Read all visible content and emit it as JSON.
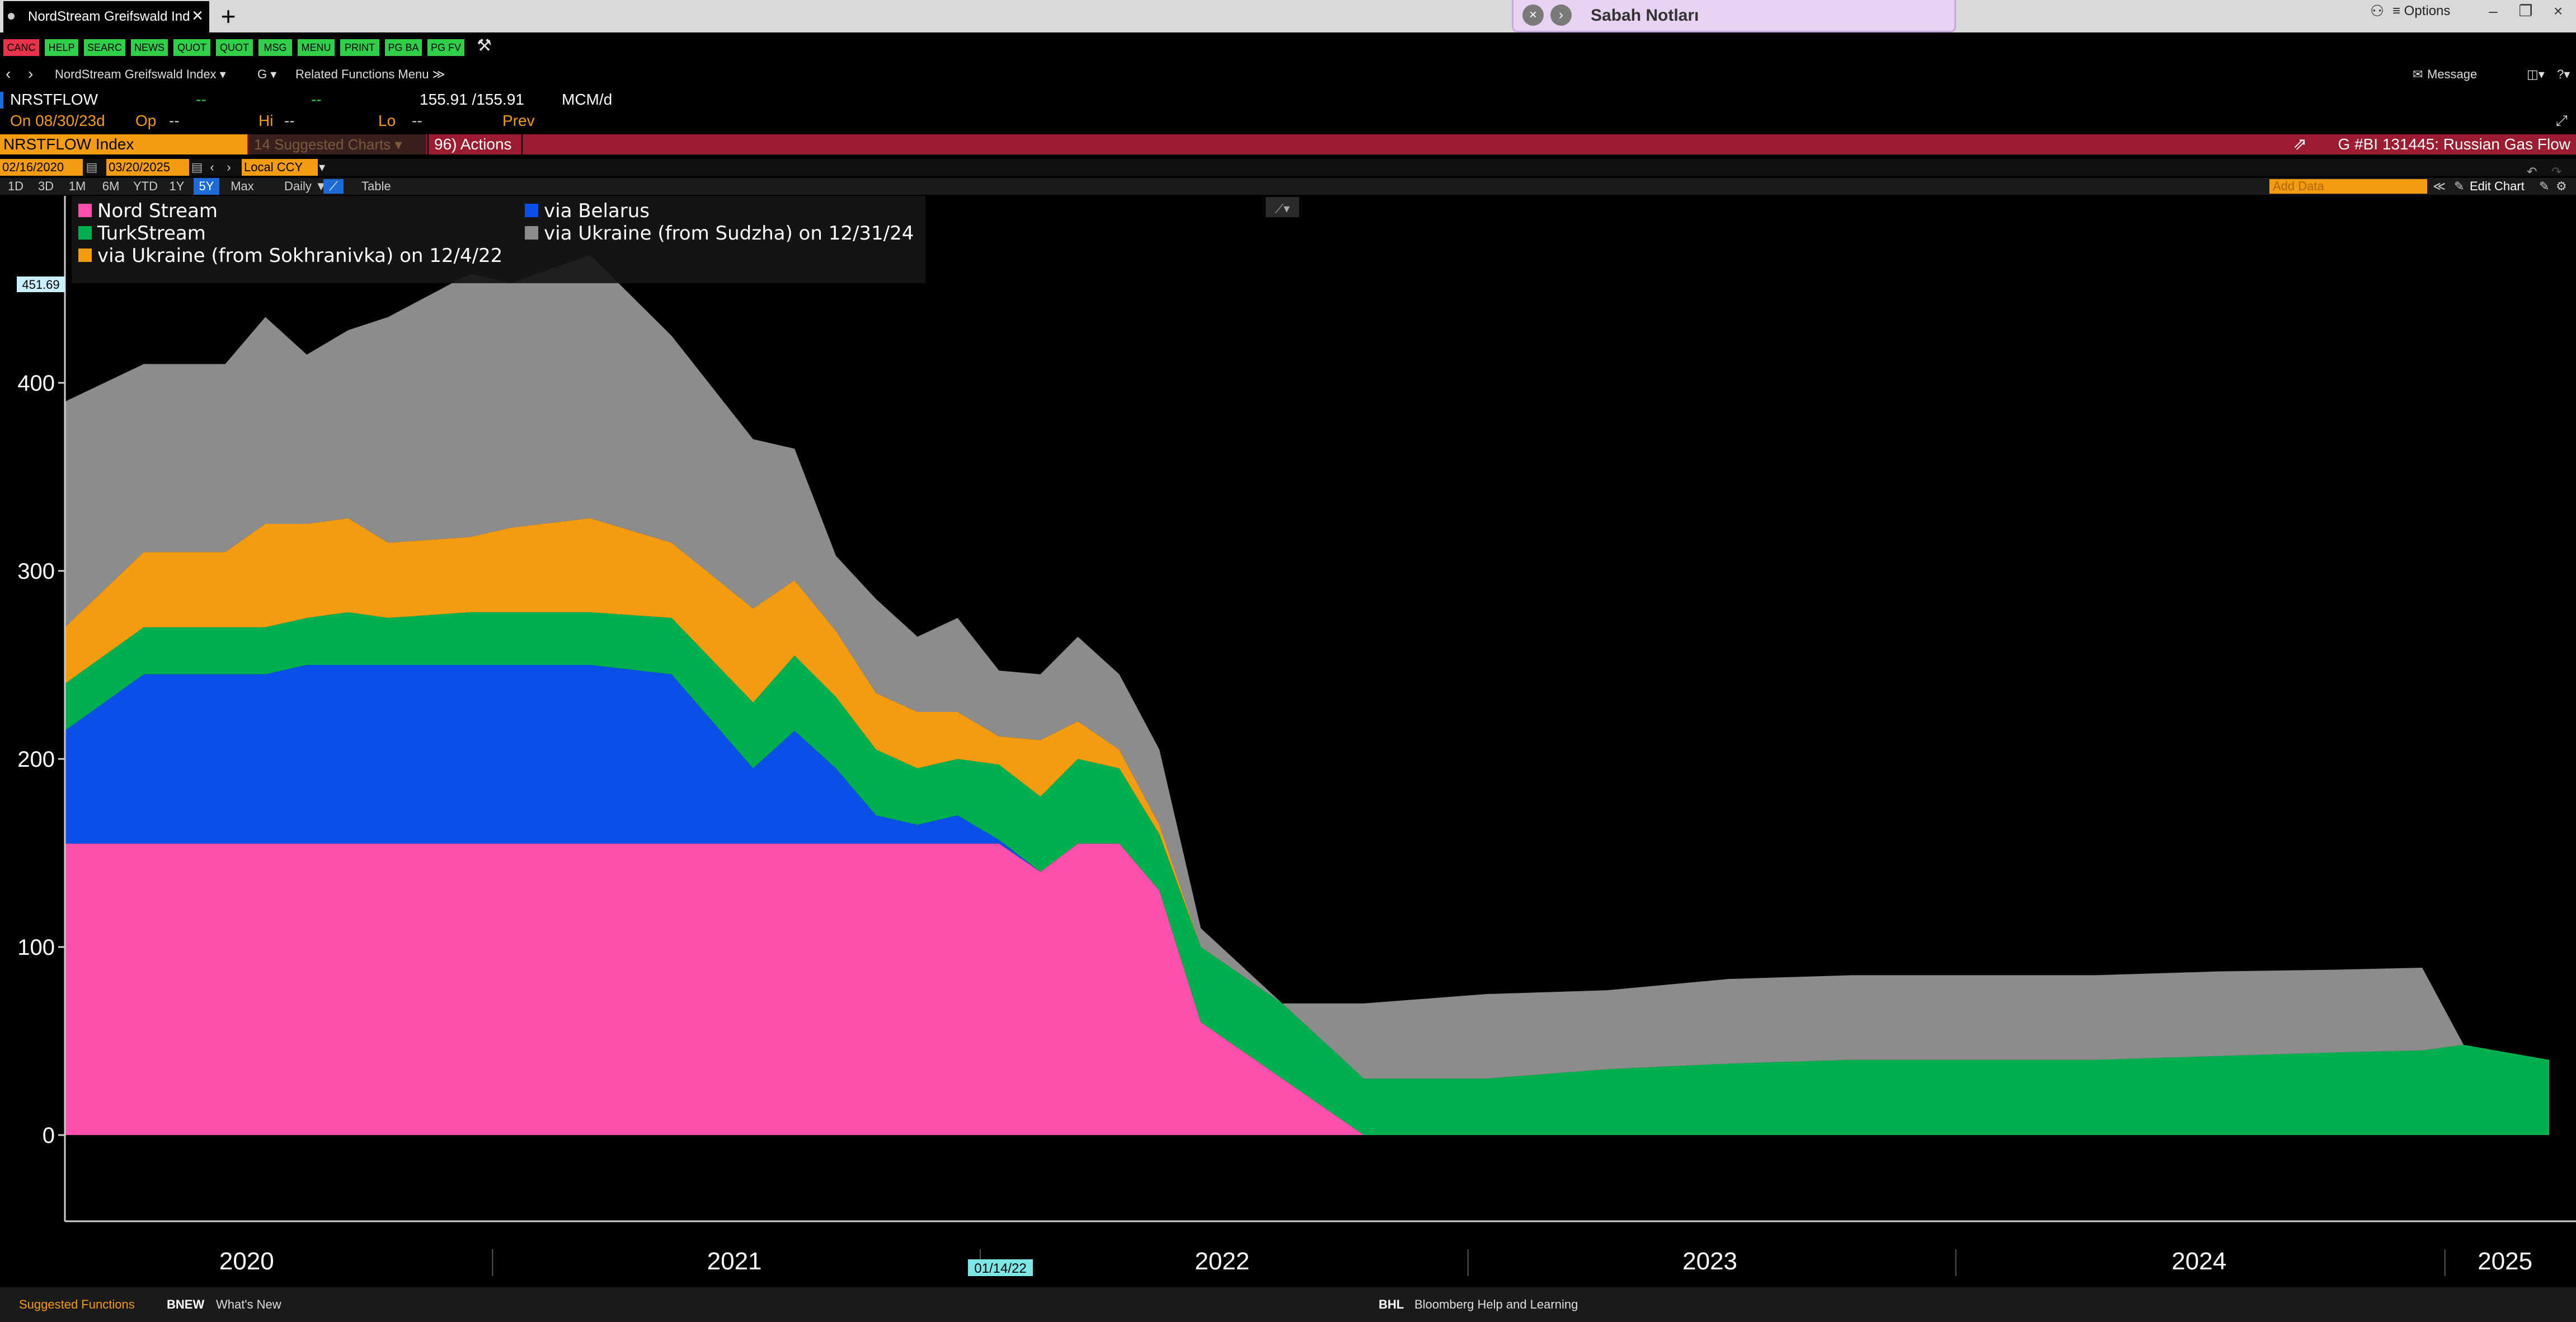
{
  "window": {
    "tab_title": "NordStream Greifswald Ind",
    "notes_title": "Sabah Notları",
    "options_label": "≡ Options"
  },
  "launchpad": {
    "buttons": [
      {
        "label": "CANC",
        "color": "#e8334a"
      },
      {
        "label": "HELP",
        "color": "#2fcf4a"
      },
      {
        "label": "SEARC",
        "color": "#2fcf4a"
      },
      {
        "label": "NEWS",
        "color": "#2fcf4a"
      },
      {
        "label": "QUOT",
        "color": "#2fcf4a"
      },
      {
        "label": "QUOT",
        "color": "#2fcf4a"
      },
      {
        "label": "MSG",
        "color": "#2fcf4a"
      },
      {
        "label": "MENU",
        "color": "#2fcf4a"
      },
      {
        "label": "PRINT",
        "color": "#2fcf4a"
      },
      {
        "label": "PG BA",
        "color": "#2fcf4a"
      },
      {
        "label": "PG FV",
        "color": "#2fcf4a"
      }
    ]
  },
  "nav": {
    "security": "NordStream Greifswald Index ▾",
    "g_menu": "G ▾",
    "related": "Related Functions Menu ≫",
    "message": "Message"
  },
  "quote": {
    "ticker": "NRSTFLOW",
    "dash1": "--",
    "dash2": "--",
    "price": "155.91 /155.91",
    "unit": "MCM/d",
    "on_label": "On 08/30/23d",
    "op_label": "Op",
    "op_value": "--",
    "hi_label": "Hi",
    "hi_value": "--",
    "lo_label": "Lo",
    "lo_value": "--",
    "prev_label": "Prev"
  },
  "header": {
    "security": "NRSTFLOW Index",
    "suggested": "14 Suggested Charts ▾",
    "actions": "96) Actions ▾",
    "bi_title": "G #BI 131445: Russian Gas Flow"
  },
  "dates": {
    "start": "02/16/2020",
    "end": "03/20/2025",
    "currency": "Local CCY"
  },
  "periods": {
    "items": [
      "1D",
      "3D",
      "1M",
      "6M",
      "YTD",
      "1Y",
      "5Y",
      "Max"
    ],
    "active": "5Y",
    "frequency": "Daily ▼",
    "table": "Table",
    "add_data": "Add Data",
    "edit_chart": "Edit Chart"
  },
  "chart_data": {
    "type": "area",
    "stacked": true,
    "y_unit": "MCM/d",
    "ylim": [
      -45,
      470
    ],
    "grid": false,
    "legend_position": "top-left",
    "last_value_label": "451.69",
    "crosshair_label": "01/14/22",
    "y_ticks": [
      0,
      100,
      200,
      300,
      400
    ],
    "x_tick_labels": [
      "2020",
      "2021",
      "2022",
      "2023",
      "2024",
      "2025"
    ],
    "x_tick_dates": [
      "2020-07-01",
      "2021-07-01",
      "2022-07-01",
      "2023-07-01",
      "2024-07-01",
      "2025-02-15"
    ],
    "x": [
      "2020-02",
      "2020-04",
      "2020-06",
      "2020-07",
      "2020-08",
      "2020-09",
      "2020-10",
      "2020-12",
      "2021-01",
      "2021-03",
      "2021-05",
      "2021-07",
      "2021-08",
      "2021-09",
      "2021-10",
      "2021-11",
      "2021-12",
      "2022-01",
      "2022-02",
      "2022-03",
      "2022-04",
      "2022-05",
      "2022-06",
      "2022-08",
      "2022-10",
      "2023-01",
      "2023-04",
      "2023-07",
      "2023-10",
      "2024-01",
      "2024-04",
      "2024-07",
      "2024-10",
      "2024-12",
      "2025-01",
      "2025-03"
    ],
    "series": [
      {
        "name": "Nord Stream",
        "color": "#ff4fac",
        "values": [
          155,
          155,
          155,
          155,
          155,
          155,
          155,
          155,
          155,
          155,
          155,
          155,
          155,
          155,
          155,
          155,
          155,
          155,
          140,
          155,
          155,
          130,
          60,
          30,
          0,
          0,
          0,
          0,
          0,
          0,
          0,
          0,
          0,
          0,
          0,
          0
        ]
      },
      {
        "name": "via Belarus",
        "color": "#0a4fe8",
        "values": [
          60,
          90,
          90,
          90,
          95,
          95,
          95,
          95,
          95,
          95,
          90,
          40,
          60,
          40,
          15,
          10,
          15,
          2,
          0,
          0,
          0,
          0,
          0,
          0,
          0,
          0,
          0,
          0,
          0,
          0,
          0,
          0,
          0,
          0,
          0,
          0
        ]
      },
      {
        "name": "TurkStream",
        "color": "#00b04f",
        "values": [
          25,
          25,
          25,
          25,
          25,
          28,
          25,
          28,
          28,
          28,
          30,
          35,
          40,
          38,
          35,
          30,
          30,
          40,
          40,
          45,
          40,
          30,
          40,
          40,
          30,
          30,
          35,
          38,
          40,
          40,
          40,
          42,
          44,
          45,
          48,
          40
        ]
      },
      {
        "name": "via Ukraine (from Sokhranivka) on 12/4/22",
        "color": "#f39c12",
        "values": [
          30,
          40,
          40,
          55,
          50,
          50,
          40,
          40,
          45,
          50,
          40,
          50,
          40,
          35,
          30,
          30,
          25,
          15,
          30,
          20,
          10,
          5,
          0,
          0,
          0,
          0,
          0,
          0,
          0,
          0,
          0,
          0,
          0,
          0,
          0,
          0
        ]
      },
      {
        "name": "via Ukraine (from Sudzha) on 12/31/24",
        "color": "#8c8c8c",
        "values": [
          120,
          100,
          100,
          110,
          90,
          100,
          120,
          140,
          130,
          140,
          110,
          90,
          70,
          40,
          50,
          40,
          50,
          35,
          35,
          45,
          40,
          40,
          10,
          0,
          40,
          45,
          42,
          45,
          45,
          45,
          45,
          45,
          44,
          44,
          0,
          0
        ]
      }
    ]
  },
  "bottom": {
    "suggested": "Suggested Functions",
    "bnew_code": "BNEW",
    "bnew_text": "What's New",
    "bhl_code": "BHL",
    "bhl_text": "Bloomberg Help and Learning"
  }
}
